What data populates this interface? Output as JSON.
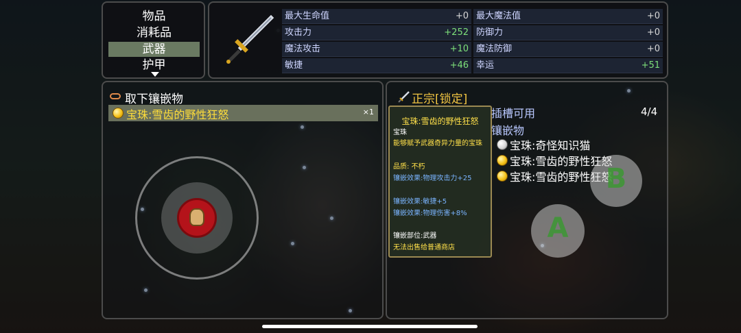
{
  "categories": [
    "物品",
    "消耗品",
    "武器",
    "护甲"
  ],
  "selected_category": "武器",
  "stats": [
    {
      "label": "最大生命值",
      "value": "+0",
      "up": false
    },
    {
      "label": "最大魔法值",
      "value": "+0",
      "up": false
    },
    {
      "label": "攻击力",
      "value": "+252",
      "up": true
    },
    {
      "label": "防御力",
      "value": "+0",
      "up": false
    },
    {
      "label": "魔法攻击",
      "value": "+10",
      "up": true
    },
    {
      "label": "魔法防御",
      "value": "+0",
      "up": false
    },
    {
      "label": "敏捷",
      "value": "+46",
      "up": true
    },
    {
      "label": "幸运",
      "value": "+51",
      "up": true
    }
  ],
  "left_panel": {
    "title": "取下镶嵌物",
    "gem_name": "宝珠:雪齿的野性狂怒",
    "gem_count": "×1"
  },
  "right_panel": {
    "title": "正宗[锁定]",
    "slots_label": "插槽可用",
    "slots_count": "4/4",
    "socket_label": "镶嵌物",
    "sockets": [
      {
        "name": "宝珠:奇怪知识猫",
        "icon": "white-orb-icon"
      },
      {
        "name": "宝珠:雪齿的野性狂怒",
        "icon": "gold-orb-icon"
      },
      {
        "name": "宝珠:雪齿的野性狂怒",
        "icon": "gold-orb-icon"
      }
    ]
  },
  "tooltip": {
    "title": "宝珠:雪齿的野性狂怒",
    "type": "宝珠",
    "desc": "能够赋予武器奇异力量的宝珠",
    "quality": "品质: 不朽",
    "effect1": "镶嵌效果:物理攻击力+25",
    "effect2": "镶嵌效果:敏捷+5",
    "effect3": "镶嵌效果:物理伤害+8%",
    "slot": "镶嵌部位:武器",
    "sell": "无法出售给普通商店"
  },
  "buttons": {
    "a": "A",
    "b": "B"
  },
  "colors": {
    "accent_gold": "#ffde3a",
    "stat_up": "#7de07a",
    "selected_bg": "#6a7a62"
  }
}
